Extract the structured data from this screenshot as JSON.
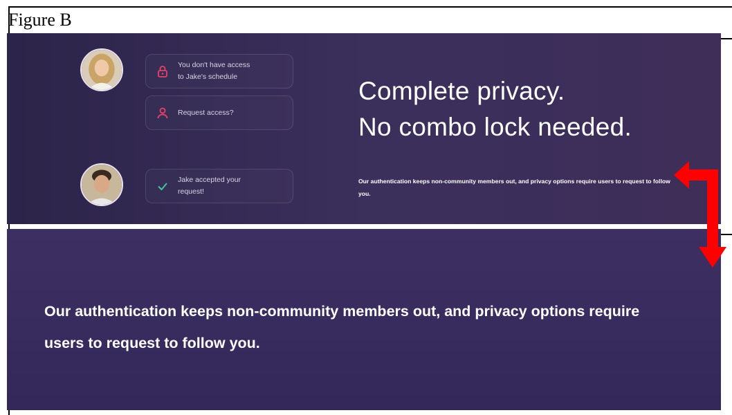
{
  "figure": {
    "label": "Figure B"
  },
  "panel": {
    "cards": [
      {
        "icon": "lock-icon",
        "line1": "You don't have access",
        "line2": "to Jake's schedule"
      },
      {
        "icon": "user-icon",
        "line1": "Request access?",
        "line2": ""
      },
      {
        "icon": "check-icon",
        "line1": "Jake accepted your",
        "line2": "request!"
      }
    ],
    "headline_line1": "Complete privacy.",
    "headline_line2": "No combo lock needed.",
    "description": "Our authentication keeps non-community members out, and privacy options require users to request to follow you."
  },
  "zoom": {
    "line1": "Our authentication keeps non-community members out, and privacy options require",
    "line2": "users to request to follow you."
  },
  "colors": {
    "panel_bg": "#3b2f5c",
    "accent_pink": "#e8416a",
    "check_green": "#43c59e",
    "arrow_red": "#ff0000"
  }
}
